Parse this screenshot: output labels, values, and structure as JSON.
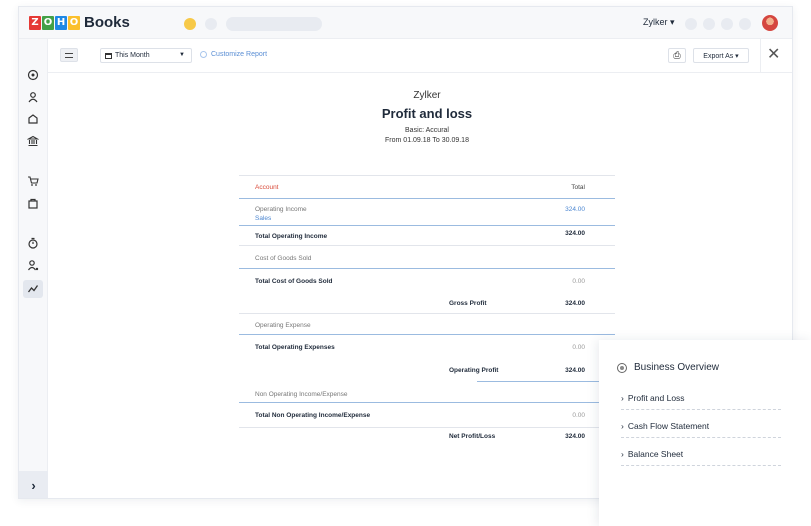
{
  "brand": {
    "logo_letters": [
      "Z",
      "O",
      "H",
      "O"
    ],
    "logo_colors": [
      "#e53935",
      "#43a047",
      "#1e88e5",
      "#fbc02d"
    ],
    "product": "Books"
  },
  "topbar": {
    "org_switcher": "Zylker ▾",
    "accent_dots": [
      "#f7c948",
      "#e8ebf1"
    ]
  },
  "nav": {
    "icons": [
      "dashboard-icon",
      "contacts-icon",
      "items-icon",
      "banking-icon",
      "sales-icon",
      "purchases-icon",
      "time-tracking-icon",
      "accountant-icon",
      "reports-icon"
    ],
    "active": "reports-icon",
    "expand_glyph": "›"
  },
  "toolbar": {
    "period": "This Month",
    "customize": "Customize Report",
    "print_glyph": "⎙",
    "export": "Export As ▾",
    "close_glyph": "✕"
  },
  "report": {
    "org": "Zylker",
    "title": "Profit and loss",
    "basis": "Basic: Accural",
    "range": "From 01.09.18 To 30.09.18",
    "col_account": "Account",
    "col_total": "Total",
    "rows": {
      "op_income_label": "Operating Income",
      "sales_label": "Sales",
      "sales_value": "324.00",
      "total_op_income_label": "Total Operating Income",
      "total_op_income_value": "324.00",
      "cogs_label": "Cost of Goods Sold",
      "total_cogs_label": "Total Cost of Goods Sold",
      "total_cogs_value": "0.00",
      "gross_profit_label": "Gross Profit",
      "gross_profit_value": "324.00",
      "op_expense_label": "Operating Expense",
      "total_op_expense_label": "Total Operating Expenses",
      "total_op_expense_value": "0.00",
      "op_profit_label": "Operating Profit",
      "op_profit_value": "324.00",
      "non_op_label": "Non Operating Income/Expense",
      "total_non_op_label": "Total Non Operating Income/Expense",
      "total_non_op_value": "0.00",
      "net_label": "Net Profit/Loss",
      "net_value": "324.00"
    }
  },
  "overview": {
    "title": "Business Overview",
    "items": [
      "Profit and Loss",
      "Cash Flow Statement",
      "Balance Sheet"
    ]
  }
}
